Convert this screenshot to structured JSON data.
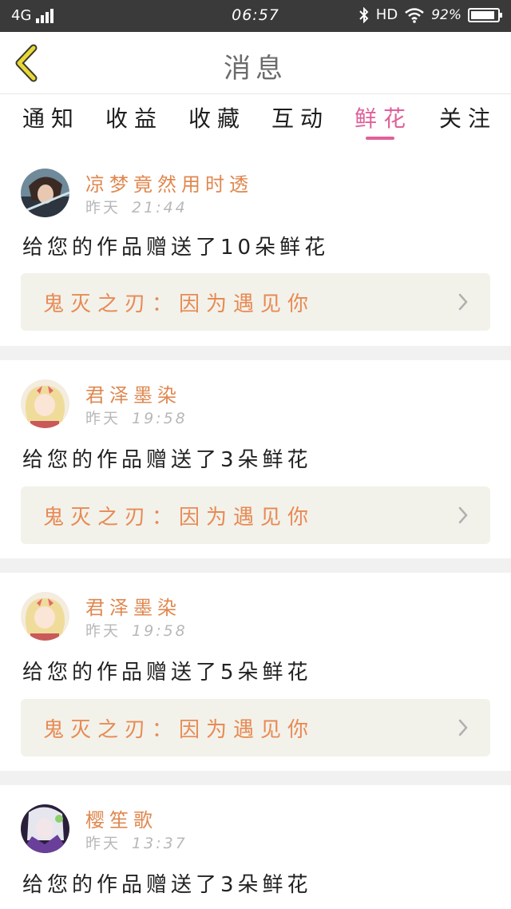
{
  "status_bar": {
    "network": "4G",
    "time": "06:57",
    "hd": "HD",
    "battery": "92%",
    "battery_level": 0.92
  },
  "header": {
    "title": "消息",
    "back_icon": "chevron-left-icon"
  },
  "tabs": [
    {
      "label": "通知",
      "active": false
    },
    {
      "label": "收益",
      "active": false
    },
    {
      "label": "收藏",
      "active": false
    },
    {
      "label": "互动",
      "active": false
    },
    {
      "label": "鲜花",
      "active": true
    },
    {
      "label": "关注",
      "active": false
    }
  ],
  "colors": {
    "accent": "#e0609a",
    "username": "#e08850",
    "work_title": "#e88a55",
    "work_bg": "#f2f2ea"
  },
  "feed": [
    {
      "username": "凉梦竟然用时透",
      "day": "昨天",
      "time": "21:44",
      "message": "给您的作品赠送了10朵鲜花",
      "work": "鬼灭之刃：因为遇见你",
      "avatar": "dark-swordsman-avatar"
    },
    {
      "username": "君泽墨染",
      "day": "昨天",
      "time": "19:58",
      "message": "给您的作品赠送了3朵鲜花",
      "work": "鬼灭之刃：因为遇见你",
      "avatar": "blonde-girl-avatar"
    },
    {
      "username": "君泽墨染",
      "day": "昨天",
      "time": "19:58",
      "message": "给您的作品赠送了5朵鲜花",
      "work": "鬼灭之刃：因为遇见你",
      "avatar": "blonde-girl-avatar"
    },
    {
      "username": "樱笙歌",
      "day": "昨天",
      "time": "13:37",
      "message": "给您的作品赠送了3朵鲜花",
      "work": "",
      "avatar": "purple-character-avatar"
    }
  ]
}
